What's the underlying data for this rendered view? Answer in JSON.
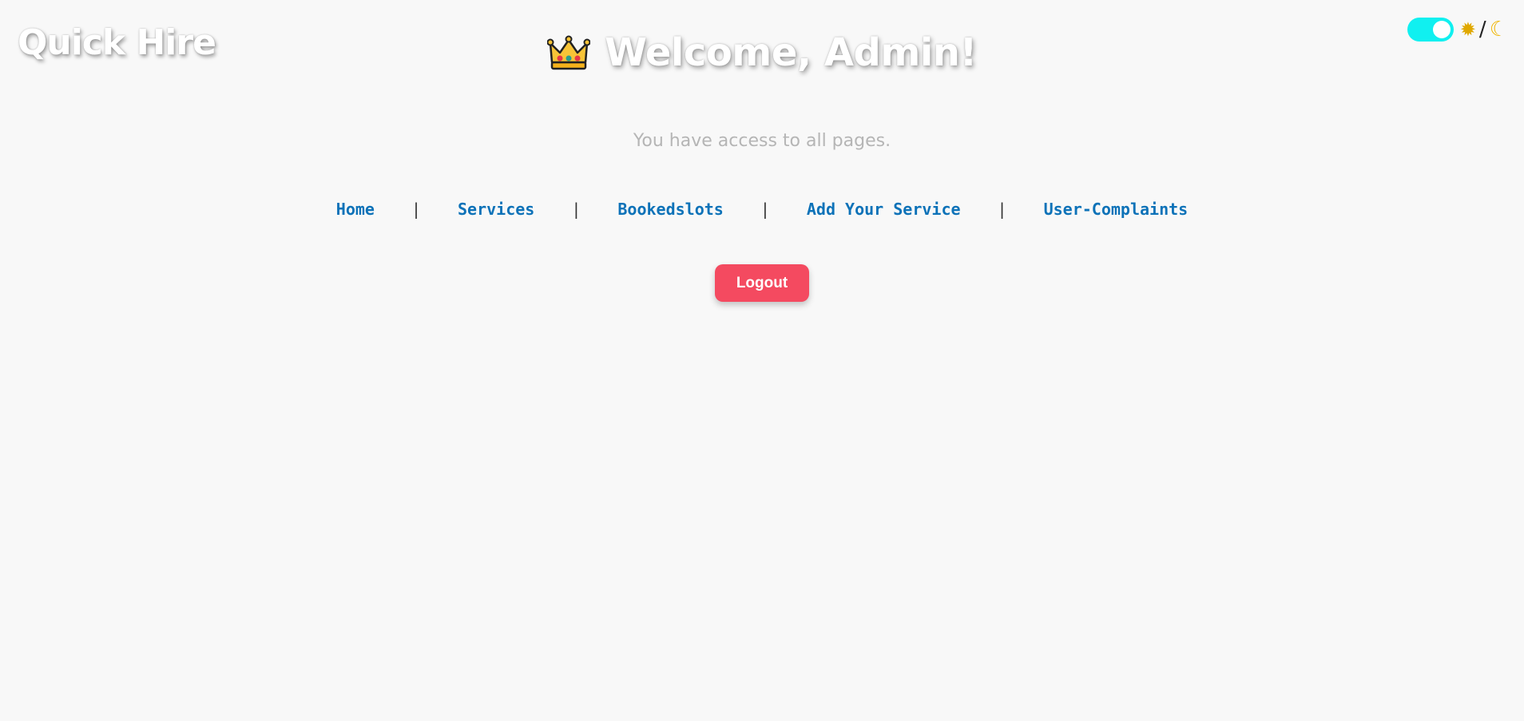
{
  "brand": {
    "name": "Quick Hire"
  },
  "theme_toggle": {
    "state": "on",
    "accent": "#10f0f0",
    "sun_icon": "sun-icon",
    "separator": "/",
    "moon_icon": "moon-icon"
  },
  "header": {
    "icon": "crown-icon",
    "title": "Welcome, Admin!"
  },
  "subtitle": "You have access to all pages.",
  "nav": {
    "items": [
      {
        "label": "Home"
      },
      {
        "label": "Services"
      },
      {
        "label": "Bookedslots"
      },
      {
        "label": "Add Your Service"
      },
      {
        "label": "User-Complaints"
      }
    ],
    "separator": "|",
    "link_color": "#0d72b8"
  },
  "actions": {
    "logout_label": "Logout",
    "logout_color": "#f44a60"
  }
}
